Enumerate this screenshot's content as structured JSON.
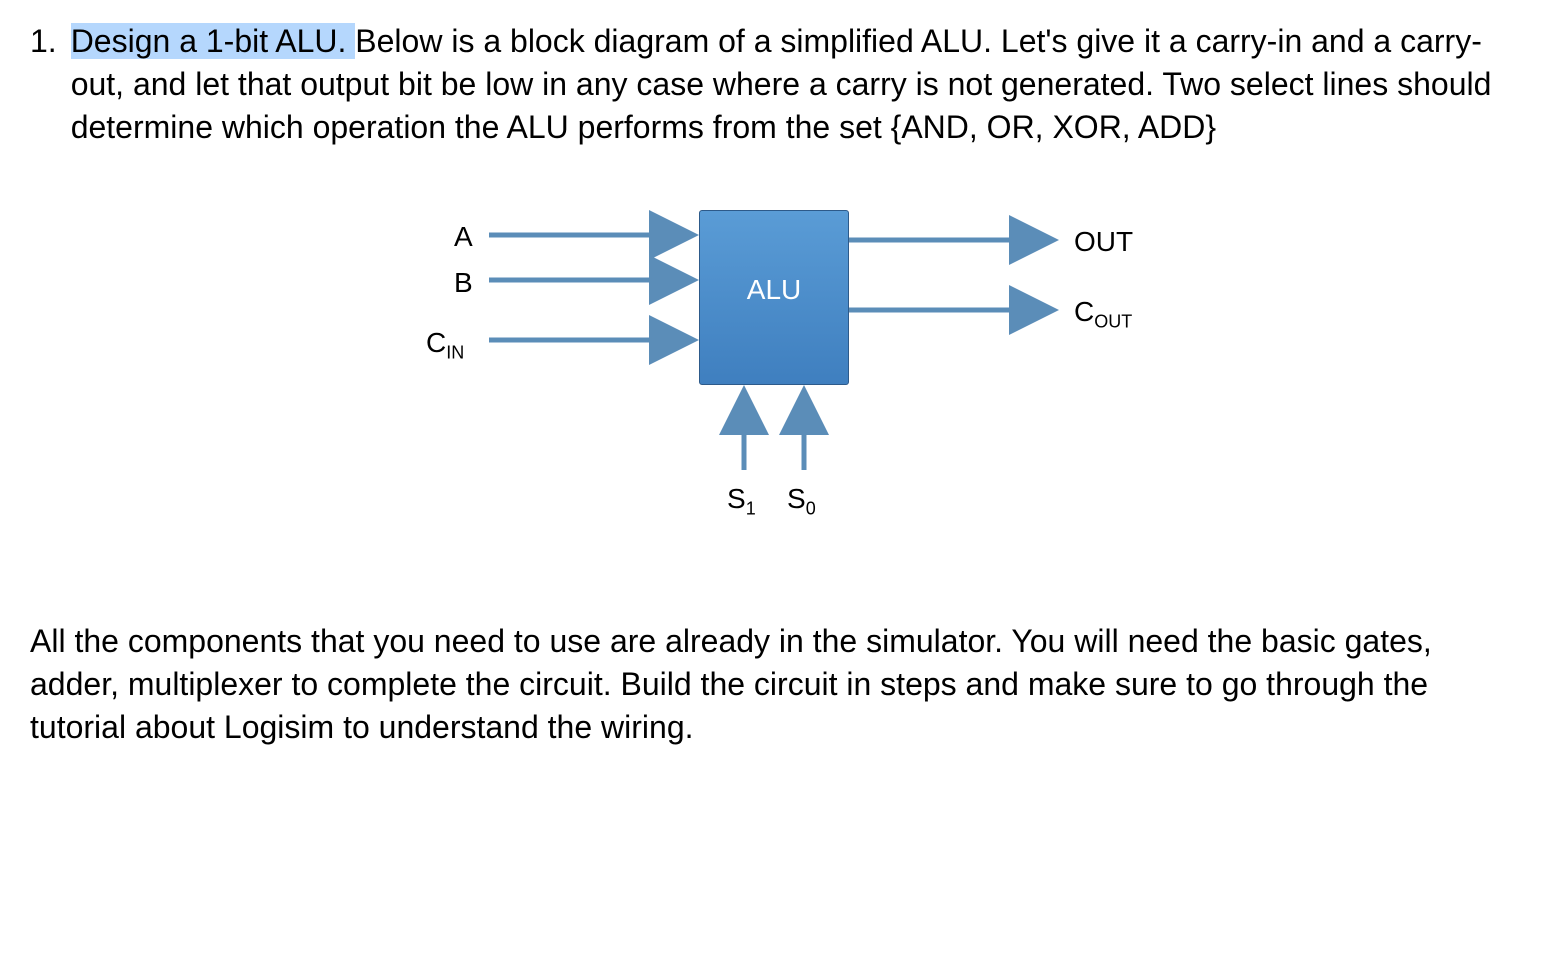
{
  "question": {
    "number": "1.",
    "highlighted_text": "Design a 1-bit ALU. ",
    "remaining_text": "Below is a block diagram of a simplified ALU. Let's give it a carry-in and a carry-out, and let that output bit be low in any case where a carry is not generated. Two select lines should determine which operation the ALU performs from the set {AND, OR, XOR, ADD}"
  },
  "diagram": {
    "alu_label": "ALU",
    "input_a": "A",
    "input_b": "B",
    "input_cin_base": "C",
    "input_cin_sub": "IN",
    "output_out": "OUT",
    "output_cout_base": "C",
    "output_cout_sub": "OUT",
    "select_s1_base": "S",
    "select_s1_sub": "1",
    "select_s0_base": "S",
    "select_s0_sub": "0"
  },
  "bottom_paragraph": "All the components that you need to use are already in the simulator. You will need the basic gates, adder, multiplexer to complete the circuit. Build the circuit in steps and make sure to go through the tutorial about Logisim to understand the wiring."
}
